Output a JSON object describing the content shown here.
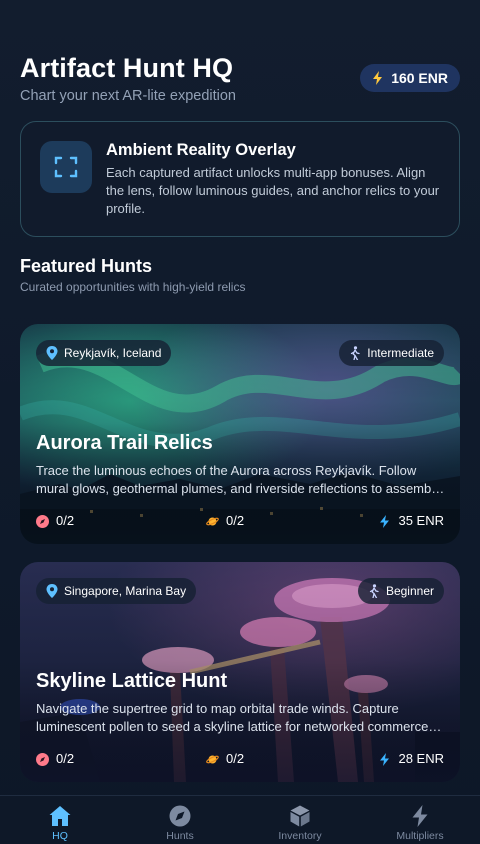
{
  "header": {
    "title": "Artifact Hunt HQ",
    "subtitle": "Chart your next AR-lite expedition",
    "energy_balance": "160 ENR"
  },
  "overlay_card": {
    "icon": "scan-frame-icon",
    "title": "Ambient Reality Overlay",
    "description": "Each captured artifact unlocks multi-app bonuses. Align the lens, follow luminous guides, and anchor relics to your profile."
  },
  "featured": {
    "title": "Featured Hunts",
    "subtitle": "Curated opportunities with high-yield relics"
  },
  "hunts": [
    {
      "location": "Reykjavík, Iceland",
      "difficulty": "Intermediate",
      "title": "Aurora Trail Relics",
      "description": "Trace the luminous echoes of the Aurora across Reykjavík. Follow mural glows, geothermal plumes, and riverside reflections to assemble the relic trail.",
      "stat_relics": "0/2",
      "stat_orbits": "0/2",
      "reward": "35 ENR"
    },
    {
      "location": "Singapore, Marina Bay",
      "difficulty": "Beginner",
      "title": "Skyline Lattice Hunt",
      "description": "Navigate the supertree grid to map orbital trade winds. Capture luminescent pollen to seed a skyline lattice for networked commerce nodes.",
      "stat_relics": "0/2",
      "stat_orbits": "0/2",
      "reward": "28 ENR"
    }
  ],
  "bottom_nav": {
    "items": [
      {
        "label": "HQ",
        "icon": "home-icon",
        "active": true
      },
      {
        "label": "Hunts",
        "icon": "compass-icon",
        "active": false
      },
      {
        "label": "Inventory",
        "icon": "cube-icon",
        "active": false
      },
      {
        "label": "Multipliers",
        "icon": "bolt-icon",
        "active": false
      }
    ]
  },
  "colors": {
    "accent": "#5ec0ff",
    "energy_bolt": "#ffc83d",
    "pill_bg": "#1f3460",
    "card_border": "#2c4e5d"
  }
}
